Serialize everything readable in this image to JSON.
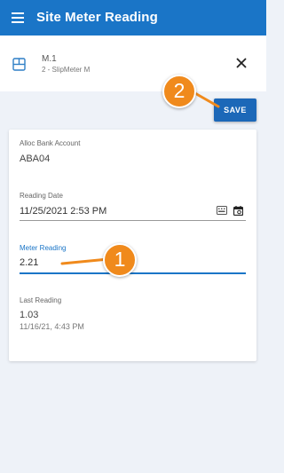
{
  "app": {
    "title": "Site Meter Reading"
  },
  "record": {
    "title": "M.1",
    "subtitle": "2 - SlipMeter M"
  },
  "actions": {
    "save_label": "SAVE"
  },
  "fields": {
    "alloc_bank_account": {
      "label": "Alloc Bank Account",
      "value": "ABA04"
    },
    "reading_date": {
      "label": "Reading Date",
      "value": "11/25/2021 2:53 PM"
    },
    "meter_reading": {
      "label": "Meter Reading",
      "value": "2.21"
    },
    "last_reading": {
      "label": "Last Reading",
      "value": "1.03",
      "date": "11/16/21, 4:43 PM"
    }
  },
  "callouts": {
    "one": "1",
    "two": "2"
  },
  "colors": {
    "primary": "#1a75c7",
    "callout": "#f08a1c"
  }
}
